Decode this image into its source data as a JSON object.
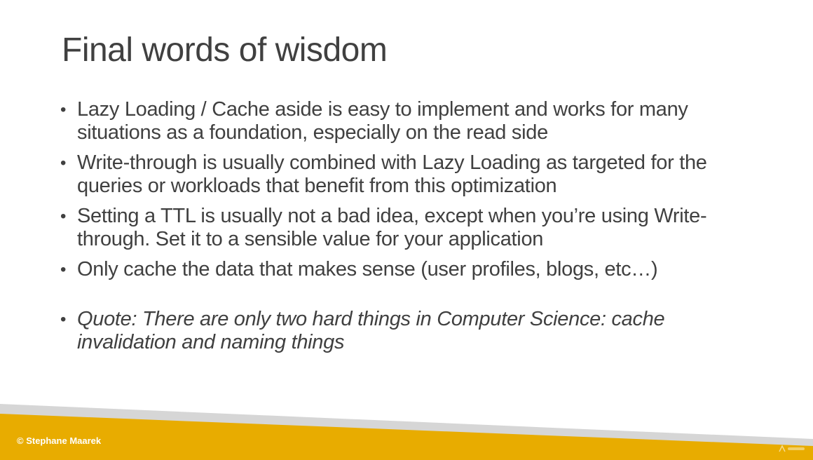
{
  "slide": {
    "title": "Final words of wisdom",
    "bullets": [
      {
        "text": "Lazy Loading / Cache aside is easy to implement and works for many situations as a foundation, especially on the read side"
      },
      {
        "text": "Write-through is usually combined with Lazy Loading as targeted for the queries or workloads that benefit from this optimization"
      },
      {
        "text": "Setting a TTL is usually not a bad idea, except when you’re using Write-through. Set it to a sensible value for your application"
      },
      {
        "text": "Only cache the data that makes sense (user profiles, blogs, etc…)"
      },
      {
        "text": "Quote: There are only two hard things in Computer Science: cache invalidation and naming things"
      }
    ],
    "bullet_glyph": "•"
  },
  "footer": {
    "copyright": "© Stephane Maarek",
    "colors": {
      "gold": "#E8AC00",
      "grey": "#D6D6D6"
    }
  }
}
